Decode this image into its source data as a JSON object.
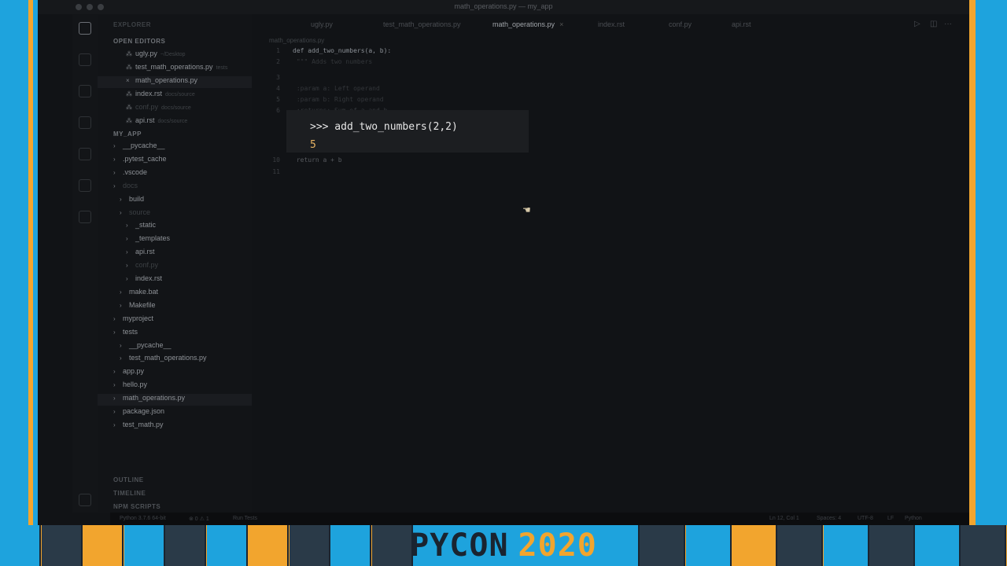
{
  "window": {
    "title": "math_operations.py — my_app"
  },
  "sidebar": {
    "explorer_title": "EXPLORER",
    "open_editors_label": "OPEN EDITORS",
    "open_editors": [
      {
        "name": "ugly.py",
        "desc": "~/Desktop",
        "icon": "python-file-icon"
      },
      {
        "name": "test_math_operations.py",
        "desc": "tests",
        "icon": "python-file-icon"
      },
      {
        "name": "math_operations.py",
        "desc": "",
        "icon": "python-file-icon"
      },
      {
        "name": "index.rst",
        "desc": "docs/source",
        "icon": "rst-file-icon"
      },
      {
        "name": "conf.py",
        "desc": "docs/source",
        "icon": "python-file-icon"
      },
      {
        "name": "api.rst",
        "desc": "docs/source",
        "icon": "rst-file-icon"
      }
    ],
    "project_label": "MY_APP",
    "tree": [
      {
        "name": "__pycache__",
        "depth": 1
      },
      {
        "name": ".pytest_cache",
        "depth": 1
      },
      {
        "name": ".vscode",
        "depth": 1
      },
      {
        "name": "docs",
        "depth": 1
      },
      {
        "name": "build",
        "depth": 2
      },
      {
        "name": "source",
        "depth": 2
      },
      {
        "name": "_static",
        "depth": 3
      },
      {
        "name": "_templates",
        "depth": 3
      },
      {
        "name": "api.rst",
        "depth": 3
      },
      {
        "name": "conf.py",
        "depth": 3
      },
      {
        "name": "index.rst",
        "depth": 3
      },
      {
        "name": "make.bat",
        "depth": 2
      },
      {
        "name": "Makefile",
        "depth": 2
      },
      {
        "name": "myproject",
        "depth": 1
      },
      {
        "name": "tests",
        "depth": 1
      },
      {
        "name": "__pycache__",
        "depth": 2
      },
      {
        "name": "test_math_operations.py",
        "depth": 2
      },
      {
        "name": "app.py",
        "depth": 1
      },
      {
        "name": "hello.py",
        "depth": 1
      },
      {
        "name": "math_operations.py",
        "depth": 1
      },
      {
        "name": "package.json",
        "depth": 1
      },
      {
        "name": "test_math.py",
        "depth": 1
      }
    ],
    "outline_label": "OUTLINE",
    "timeline_label": "TIMELINE",
    "npm_label": "NPM SCRIPTS"
  },
  "tabs": [
    {
      "label": "ugly.py",
      "active": false
    },
    {
      "label": "test_math_operations.py",
      "active": false
    },
    {
      "label": "math_operations.py",
      "active": true
    },
    {
      "label": "index.rst",
      "active": false
    },
    {
      "label": "conf.py",
      "active": false
    },
    {
      "label": "api.rst",
      "active": false
    }
  ],
  "breadcrumb": "math_operations.py",
  "code": [
    {
      "ln": "1",
      "text": "def add_two_numbers(a, b):"
    },
    {
      "ln": "2",
      "text": "    \"\"\" Adds two numbers"
    },
    {
      "ln": "3",
      "text": ""
    },
    {
      "ln": "4",
      "text": "    :param a: Left operand"
    },
    {
      "ln": "5",
      "text": "    :param b: Right operand"
    },
    {
      "ln": "6",
      "text": "    :returns: Sum of a and b"
    },
    {
      "ln": "10",
      "text": "    return a + b"
    },
    {
      "ln": "11",
      "text": ""
    }
  ],
  "overlay": {
    "prompt": ">>> add_two_numbers(2,2)",
    "result": "5"
  },
  "statusbar": {
    "interpreter": "Python 3.7.6 64-bit",
    "problems": "⊗ 0 ⚠ 1",
    "run_tests": "Run Tests",
    "position": "Ln 12, Col 1",
    "spaces": "Spaces: 4",
    "encoding": "UTF-8",
    "eol": "LF",
    "language": "Python"
  },
  "banner": {
    "word1": "PYCON",
    "word2": "2020"
  },
  "colors": {
    "frame": "#1ea3dd",
    "accent": "#f2a52e",
    "editor_bg": "#111316",
    "result": "#e8b464"
  }
}
